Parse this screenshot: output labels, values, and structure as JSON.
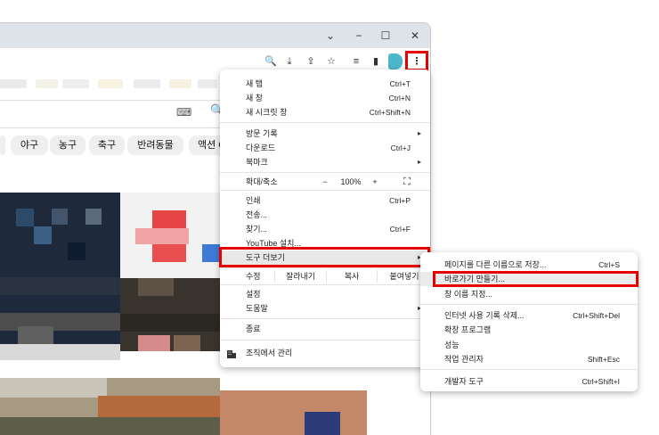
{
  "window": {
    "controls": {
      "minimize": "−",
      "maximize": "☐",
      "close": "✕",
      "tablist": "⌄"
    }
  },
  "toolbar": {
    "icons": [
      "search-icon",
      "download-icon",
      "share-icon",
      "star-icon",
      "reading-list-icon",
      "side-panel-icon",
      "profile-icon",
      "more-menu-icon"
    ],
    "glyphs": {
      "search": "🔍",
      "download": "⤓",
      "share": "⇪",
      "star": "☆",
      "reading": "≡",
      "panel": "▮",
      "more": "⋮"
    }
  },
  "content": {
    "keyboard_icon": "⌨",
    "search_icon": "🔍",
    "chips": [
      "야구",
      "농구",
      "축구",
      "반려동물",
      "액션 C"
    ]
  },
  "menu": {
    "new_tab": {
      "label": "새 탭",
      "shortcut": "Ctrl+T"
    },
    "new_window": {
      "label": "새 창",
      "shortcut": "Ctrl+N"
    },
    "new_incognito": {
      "label": "새 시크릿 창",
      "shortcut": "Ctrl+Shift+N"
    },
    "history": {
      "label": "방문 기록"
    },
    "downloads": {
      "label": "다운로드",
      "shortcut": "Ctrl+J"
    },
    "bookmarks": {
      "label": "북마크"
    },
    "zoom": {
      "label": "확대/축소",
      "minus": "−",
      "value": "100%",
      "plus": "+",
      "fullscreen": "⛶"
    },
    "print": {
      "label": "인쇄",
      "shortcut": "Ctrl+P"
    },
    "cast": {
      "label": "전송..."
    },
    "find": {
      "label": "찾기...",
      "shortcut": "Ctrl+F"
    },
    "youtube_install": {
      "label": "YouTube 설치..."
    },
    "more_tools": {
      "label": "도구 더보기"
    },
    "edit": {
      "label": "수정",
      "cut": "잘라내기",
      "copy": "복사",
      "paste": "붙여넣기"
    },
    "settings": {
      "label": "설정"
    },
    "help": {
      "label": "도움말"
    },
    "exit": {
      "label": "종료"
    },
    "managed": {
      "label": "조직에서 관리"
    },
    "arrow": "▸"
  },
  "submenu": {
    "save_page": {
      "label": "페이지를 다른 이름으로 저장...",
      "shortcut": "Ctrl+S"
    },
    "create_shortcut": {
      "label": "바로가기 만들기..."
    },
    "name_window": {
      "label": "창 이름 지정..."
    },
    "clear_data": {
      "label": "인터넷 사용 기록 삭제...",
      "shortcut": "Ctrl+Shift+Del"
    },
    "extensions": {
      "label": "확장 프로그램"
    },
    "performance": {
      "label": "성능"
    },
    "task_manager": {
      "label": "작업 관리자",
      "shortcut": "Shift+Esc"
    },
    "dev_tools": {
      "label": "개발자 도구",
      "shortcut": "Ctrl+Shift+I"
    }
  },
  "colors": {
    "highlight": "#e60000",
    "titlebar": "#dee3ea",
    "profile": "#4bb7c9"
  }
}
